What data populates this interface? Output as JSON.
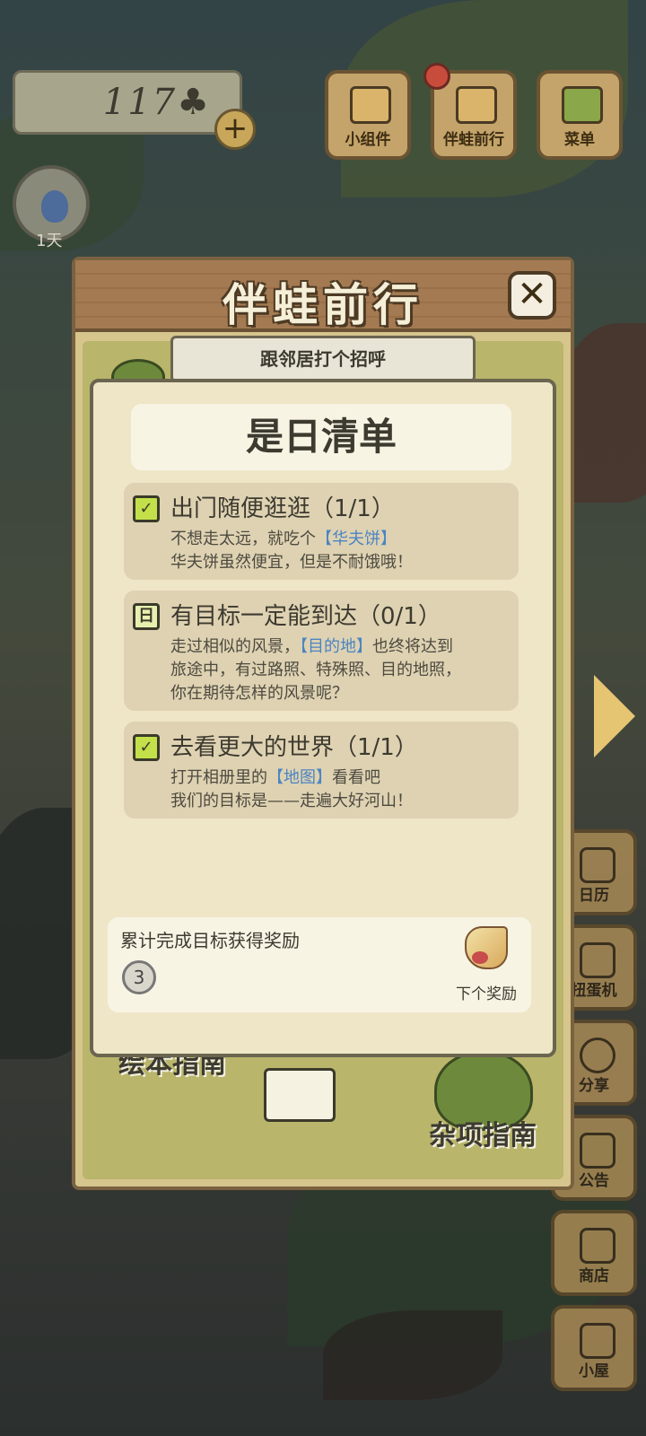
{
  "currency": {
    "value": "117",
    "suffix": "♣",
    "add": "+"
  },
  "top_buttons": [
    {
      "label": "小组件"
    },
    {
      "label": "伴蛙前行"
    },
    {
      "label": "菜单"
    }
  ],
  "avatar": {
    "days": "1天"
  },
  "side_buttons": [
    {
      "label": "日历"
    },
    {
      "label": "扭蛋机"
    },
    {
      "label": "分享"
    },
    {
      "label": "公告"
    },
    {
      "label": "商店"
    },
    {
      "label": "小屋"
    }
  ],
  "panel": {
    "title": "伴蛙前行",
    "close": "✕",
    "banner": "跟邻居打个招呼",
    "bottom_left": "绘本指南",
    "bottom_right": "杂项指南"
  },
  "checklist": {
    "title": "是日清单",
    "tasks": [
      {
        "title": "出门随便逛逛（1/1）",
        "line1_pre": "不想走太远，就吃个",
        "line1_hl": "【华夫饼】",
        "line2": "华夫饼虽然便宜，但是不耐饿哦！",
        "done": true
      },
      {
        "title": "有目标一定能到达（0/1）",
        "line1_pre": "走过相似的风景，",
        "line1_hl": "【目的地】",
        "line1_post": "也终将达到",
        "line2": "旅途中，有过路照、特殊照、目的地照，",
        "line3": "你在期待怎样的风景呢？",
        "done": false
      },
      {
        "title": "去看更大的世界（1/1）",
        "line1_pre": "打开相册里的",
        "line1_hl": "【地图】",
        "line1_post": "看看吧",
        "line2": "我们的目标是——走遍大好河山！",
        "done": true
      }
    ],
    "reward": {
      "title": "累计完成目标获得奖励",
      "count": "3",
      "next": "下个奖励"
    }
  }
}
